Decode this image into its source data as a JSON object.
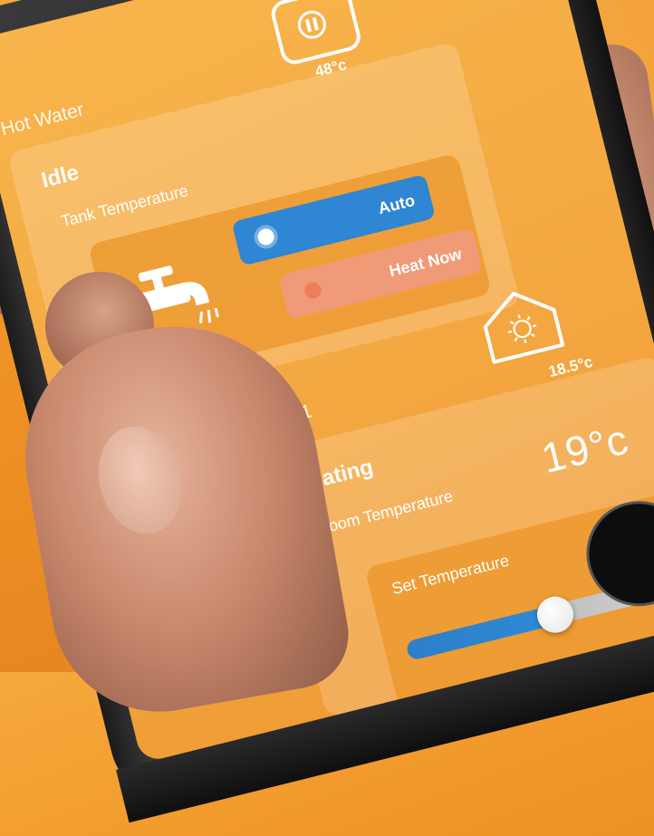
{
  "hot_water": {
    "section_label": "Hot Water",
    "tank_reading": "48°c",
    "status": "Idle",
    "sub_label": "Tank Temperature",
    "buttons": {
      "auto": "Auto",
      "heat_now": "Heat Now"
    },
    "icons": {
      "tank": "pause-icon",
      "tap": "tap-icon"
    }
  },
  "zone": {
    "section_label": "Zone 1",
    "zone_reading": "18.5°c",
    "status": "Heating",
    "room_label": "Room Temperature",
    "room_temperature": "19°c",
    "set_label": "Set Temperature",
    "slider_level": 0.48,
    "icons": {
      "house": "sun-icon"
    }
  },
  "colors": {
    "accent_orange": "#f4a640",
    "auto_blue": "#2f86d3",
    "heat_now_salmon": "#f09a77"
  }
}
